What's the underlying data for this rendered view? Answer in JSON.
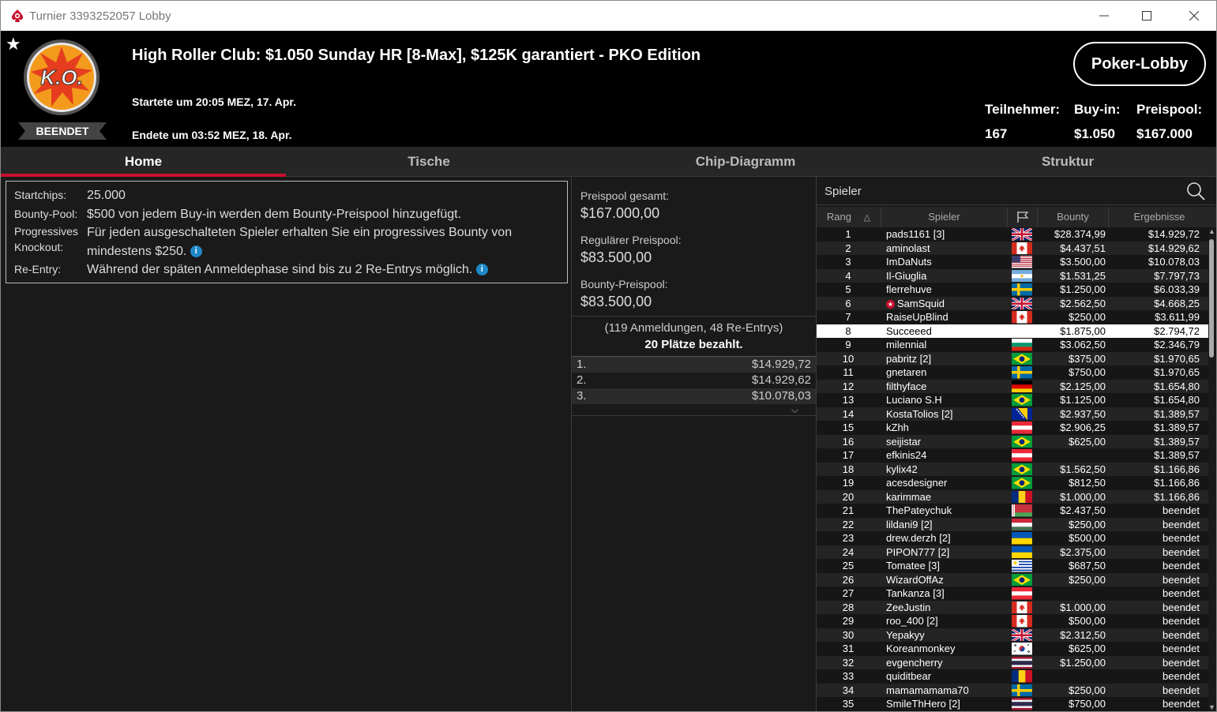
{
  "window": {
    "title": "Turnier 3393252057 Lobby"
  },
  "header": {
    "logo_text": "K.O.",
    "status_badge": "BEENDET",
    "title": "High Roller Club: $1.050 Sunday HR [8-Max], $125K garantiert - PKO Edition",
    "started": "Startete um 20:05 MEZ, 17. Apr.",
    "ended": "Endete um 03:52 MEZ, 18. Apr.",
    "lobby_button": "Poker-Lobby",
    "stats": {
      "entrants_label": "Teilnehmer:",
      "entrants": "167",
      "buyin_label": "Buy-in:",
      "buyin": "$1.050",
      "prizepool_label": "Preispool:",
      "prizepool": "$167.000"
    }
  },
  "tabs": [
    "Home",
    "Tische",
    "Chip-Diagramm",
    "Struktur"
  ],
  "info": {
    "startchips_label": "Startchips:",
    "startchips": "25.000",
    "bounty_label": "Bounty-Pool:",
    "bounty": "$500 von jedem Buy-in werden dem Bounty-Preispool hinzugefügt.",
    "pko_label_1": "Progressives",
    "pko_label_2": "Knockout:",
    "pko_1": "Für jeden ausgeschalteten Spieler erhalten Sie ein progressives Bounty von",
    "pko_2": "mindestens $250.",
    "reentry_label": "Re-Entry:",
    "reentry": "Während der späten Anmeldephase sind bis zu 2 Re-Entrys möglich."
  },
  "prizes": {
    "total_label": "Preispool gesamt:",
    "total": "$167.000,00",
    "regular_label": "Regulärer Preispool:",
    "regular": "$83.500,00",
    "bounty_label": "Bounty-Preispool:",
    "bounty": "$83.500,00",
    "registrations": "(119 Anmeldungen, 48 Re-Entrys)",
    "paid_places": "20 Plätze bezahlt.",
    "payouts": [
      {
        "place": "1.",
        "amount": "$14.929,72"
      },
      {
        "place": "2.",
        "amount": "$14.929,62"
      },
      {
        "place": "3.",
        "amount": "$10.078,03"
      }
    ]
  },
  "players": {
    "search_label": "Spieler",
    "columns": {
      "rank": "Rang",
      "player": "Spieler",
      "bounty": "Bounty",
      "results": "Ergebnisse"
    },
    "highlight_rank": "8",
    "rows": [
      {
        "rank": "1",
        "name": "pads1161 [3]",
        "flag": "gb",
        "bounty": "$28.374,99",
        "result": "$14.929,72"
      },
      {
        "rank": "2",
        "name": "aminolast",
        "flag": "ca",
        "bounty": "$4.437,51",
        "result": "$14.929,62"
      },
      {
        "rank": "3",
        "name": "ImDaNuts",
        "flag": "us",
        "bounty": "$3.500,00",
        "result": "$10.078,03"
      },
      {
        "rank": "4",
        "name": "Il-Giuglia",
        "flag": "ar",
        "bounty": "$1.531,25",
        "result": "$7.797,73"
      },
      {
        "rank": "5",
        "name": "flerrehuve",
        "flag": "se",
        "bounty": "$1.250,00",
        "result": "$6.033,39"
      },
      {
        "rank": "6",
        "name": "SamSquid",
        "flag": "gb",
        "bounty": "$2.562,50",
        "result": "$4.668,25",
        "star": true
      },
      {
        "rank": "7",
        "name": "RaiseUpBlind",
        "flag": "ca",
        "bounty": "$250,00",
        "result": "$3.611,99"
      },
      {
        "rank": "8",
        "name": "Succeeed",
        "flag": "none",
        "bounty": "$1.875,00",
        "result": "$2.794,72"
      },
      {
        "rank": "9",
        "name": "milennial",
        "flag": "bg",
        "bounty": "$3.062,50",
        "result": "$2.346,79"
      },
      {
        "rank": "10",
        "name": "pabritz [2]",
        "flag": "br",
        "bounty": "$375,00",
        "result": "$1.970,65"
      },
      {
        "rank": "11",
        "name": "gnetaren",
        "flag": "se",
        "bounty": "$750,00",
        "result": "$1.970,65"
      },
      {
        "rank": "12",
        "name": "filthyface",
        "flag": "de",
        "bounty": "$2.125,00",
        "result": "$1.654,80"
      },
      {
        "rank": "13",
        "name": "Luciano S.H",
        "flag": "br",
        "bounty": "$1.125,00",
        "result": "$1.654,80"
      },
      {
        "rank": "14",
        "name": "KostaTolios [2]",
        "flag": "ba",
        "bounty": "$2.937,50",
        "result": "$1.389,57"
      },
      {
        "rank": "15",
        "name": "kZhh",
        "flag": "at",
        "bounty": "$2.906,25",
        "result": "$1.389,57"
      },
      {
        "rank": "16",
        "name": "seijistar",
        "flag": "br",
        "bounty": "$625,00",
        "result": "$1.389,57"
      },
      {
        "rank": "17",
        "name": "efkinis24",
        "flag": "at",
        "bounty": "",
        "result": "$1.389,57"
      },
      {
        "rank": "18",
        "name": "kylix42",
        "flag": "br",
        "bounty": "$1.562,50",
        "result": "$1.166,86"
      },
      {
        "rank": "19",
        "name": "acesdesigner",
        "flag": "br",
        "bounty": "$812,50",
        "result": "$1.166,86"
      },
      {
        "rank": "20",
        "name": "karimmae",
        "flag": "ro",
        "bounty": "$1.000,00",
        "result": "$1.166,86"
      },
      {
        "rank": "21",
        "name": "ThePateychuk",
        "flag": "by",
        "bounty": "$2.437,50",
        "result": "beendet"
      },
      {
        "rank": "22",
        "name": "lildani9 [2]",
        "flag": "hu",
        "bounty": "$250,00",
        "result": "beendet"
      },
      {
        "rank": "23",
        "name": "drew.derzh [2]",
        "flag": "ua",
        "bounty": "$500,00",
        "result": "beendet"
      },
      {
        "rank": "24",
        "name": "PIPON777 [2]",
        "flag": "ua",
        "bounty": "$2.375,00",
        "result": "beendet"
      },
      {
        "rank": "25",
        "name": "Tomatee [3]",
        "flag": "uy",
        "bounty": "$687,50",
        "result": "beendet"
      },
      {
        "rank": "26",
        "name": "WizardOffAz",
        "flag": "br",
        "bounty": "$250,00",
        "result": "beendet"
      },
      {
        "rank": "27",
        "name": "Tankanza [3]",
        "flag": "at",
        "bounty": "",
        "result": "beendet"
      },
      {
        "rank": "28",
        "name": "ZeeJustin",
        "flag": "ca",
        "bounty": "$1.000,00",
        "result": "beendet"
      },
      {
        "rank": "29",
        "name": "roo_400 [2]",
        "flag": "ca",
        "bounty": "$500,00",
        "result": "beendet"
      },
      {
        "rank": "30",
        "name": "Yepakyy",
        "flag": "gb",
        "bounty": "$2.312,50",
        "result": "beendet"
      },
      {
        "rank": "31",
        "name": "Koreanmonkey",
        "flag": "kr",
        "bounty": "$625,00",
        "result": "beendet"
      },
      {
        "rank": "32",
        "name": "evgencherry",
        "flag": "th",
        "bounty": "$1.250,00",
        "result": "beendet"
      },
      {
        "rank": "33",
        "name": "quiditbear",
        "flag": "ro",
        "bounty": "",
        "result": "beendet"
      },
      {
        "rank": "34",
        "name": "mamamamama70",
        "flag": "se",
        "bounty": "$250,00",
        "result": "beendet"
      },
      {
        "rank": "35",
        "name": "SmileThHero [2]",
        "flag": "th",
        "bounty": "$750,00",
        "result": "beendet"
      }
    ]
  },
  "colors": {
    "accent": "#c8102e",
    "highlight_row": "#ffffff"
  }
}
